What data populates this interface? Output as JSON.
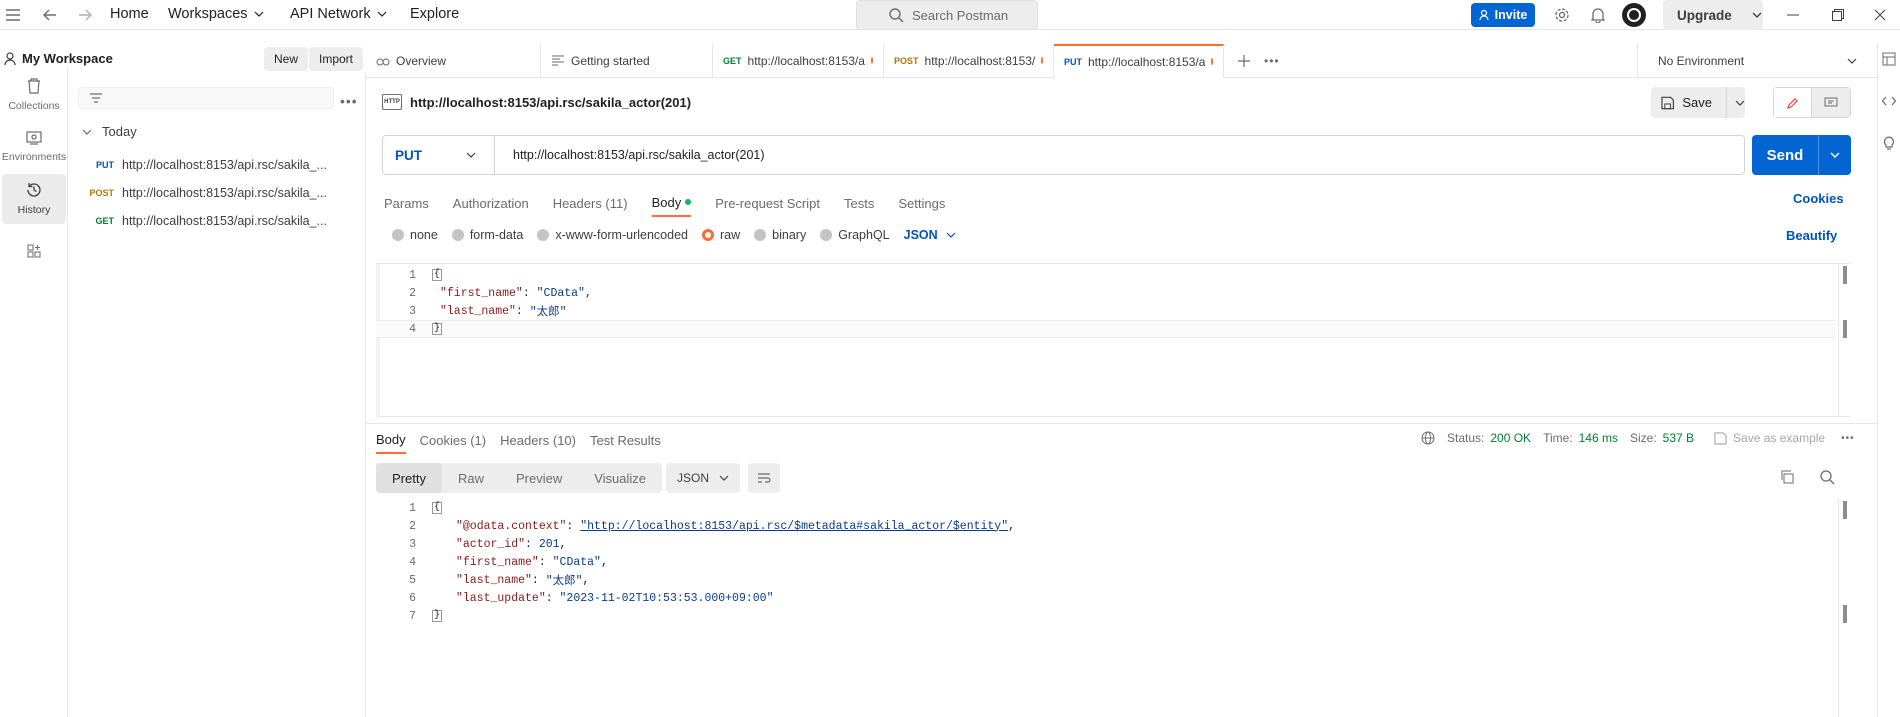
{
  "topbar": {
    "nav": [
      "Home",
      "Workspaces",
      "API Network",
      "Explore"
    ],
    "search_placeholder": "Search Postman",
    "invite": "Invite",
    "upgrade": "Upgrade"
  },
  "workspace": {
    "title": "My Workspace",
    "new_label": "New",
    "import_label": "Import"
  },
  "rail": {
    "items": [
      {
        "label": "Collections",
        "icon": "trash-can-icon"
      },
      {
        "label": "Environments",
        "icon": "environment-icon"
      },
      {
        "label": "History",
        "icon": "history-icon"
      },
      {
        "label": "",
        "icon": "apps-icon"
      }
    ]
  },
  "history": {
    "group": "Today",
    "items": [
      {
        "method": "PUT",
        "url": "http://localhost:8153/api.rsc/sakila_..."
      },
      {
        "method": "POST",
        "url": "http://localhost:8153/api.rsc/sakila_..."
      },
      {
        "method": "GET",
        "url": "http://localhost:8153/api.rsc/sakila_..."
      }
    ]
  },
  "tabs": [
    {
      "label": "Overview",
      "method": "",
      "dirty": false
    },
    {
      "label": "Getting started",
      "method": "",
      "dirty": false
    },
    {
      "label": "http://localhost:8153/a",
      "method": "GET",
      "dirty": true
    },
    {
      "label": "http://localhost:8153/",
      "method": "POST",
      "dirty": true
    },
    {
      "label": "http://localhost:8153/a",
      "method": "PUT",
      "dirty": true
    }
  ],
  "environment": "No Environment",
  "request": {
    "title": "http://localhost:8153/api.rsc/sakila_actor(201)",
    "save_label": "Save",
    "method": "PUT",
    "url": "http://localhost:8153/api.rsc/sakila_actor(201)",
    "send_label": "Send",
    "tabs": [
      "Params",
      "Authorization",
      "Headers (11)",
      "Body",
      "Pre-request Script",
      "Tests",
      "Settings"
    ],
    "cookies_label": "Cookies",
    "body_options": [
      "none",
      "form-data",
      "x-www-form-urlencoded",
      "raw",
      "binary",
      "GraphQL"
    ],
    "body_format": "JSON",
    "beautify_label": "Beautify",
    "body_lines": [
      {
        "n": "1",
        "key": "",
        "val": "",
        "brace": "{"
      },
      {
        "n": "2",
        "key": "\"first_name\"",
        "val": "\"CData\","
      },
      {
        "n": "3",
        "key": "\"last_name\"",
        "val": "\"太郎\""
      },
      {
        "n": "4",
        "key": "",
        "val": "",
        "brace": "}"
      }
    ]
  },
  "response": {
    "tabs": [
      "Body",
      "Cookies (1)",
      "Headers (10)",
      "Test Results"
    ],
    "status_label": "Status:",
    "status_value": "200 OK",
    "time_label": "Time:",
    "time_value": "146 ms",
    "size_label": "Size:",
    "size_value": "537 B",
    "save_example": "Save as example",
    "views": [
      "Pretty",
      "Raw",
      "Preview",
      "Visualize"
    ],
    "format": "JSON",
    "lines": [
      {
        "n": "1",
        "brace": "{"
      },
      {
        "n": "2",
        "key": "\"@odata.context\"",
        "val": "\"http://localhost:8153/api.rsc/$metadata#sakila_actor/$entity\"",
        "suffix": ","
      },
      {
        "n": "3",
        "key": "\"actor_id\"",
        "val": "201",
        "suffix": ","
      },
      {
        "n": "4",
        "key": "\"first_name\"",
        "val": "\"CData\"",
        "suffix": ","
      },
      {
        "n": "5",
        "key": "\"last_name\"",
        "val": "\"太郎\"",
        "suffix": ","
      },
      {
        "n": "6",
        "key": "\"last_update\"",
        "val": "\"2023-11-02T10:53:53.000+09:00\"",
        "suffix": ""
      },
      {
        "n": "7",
        "brace": "}"
      }
    ]
  }
}
